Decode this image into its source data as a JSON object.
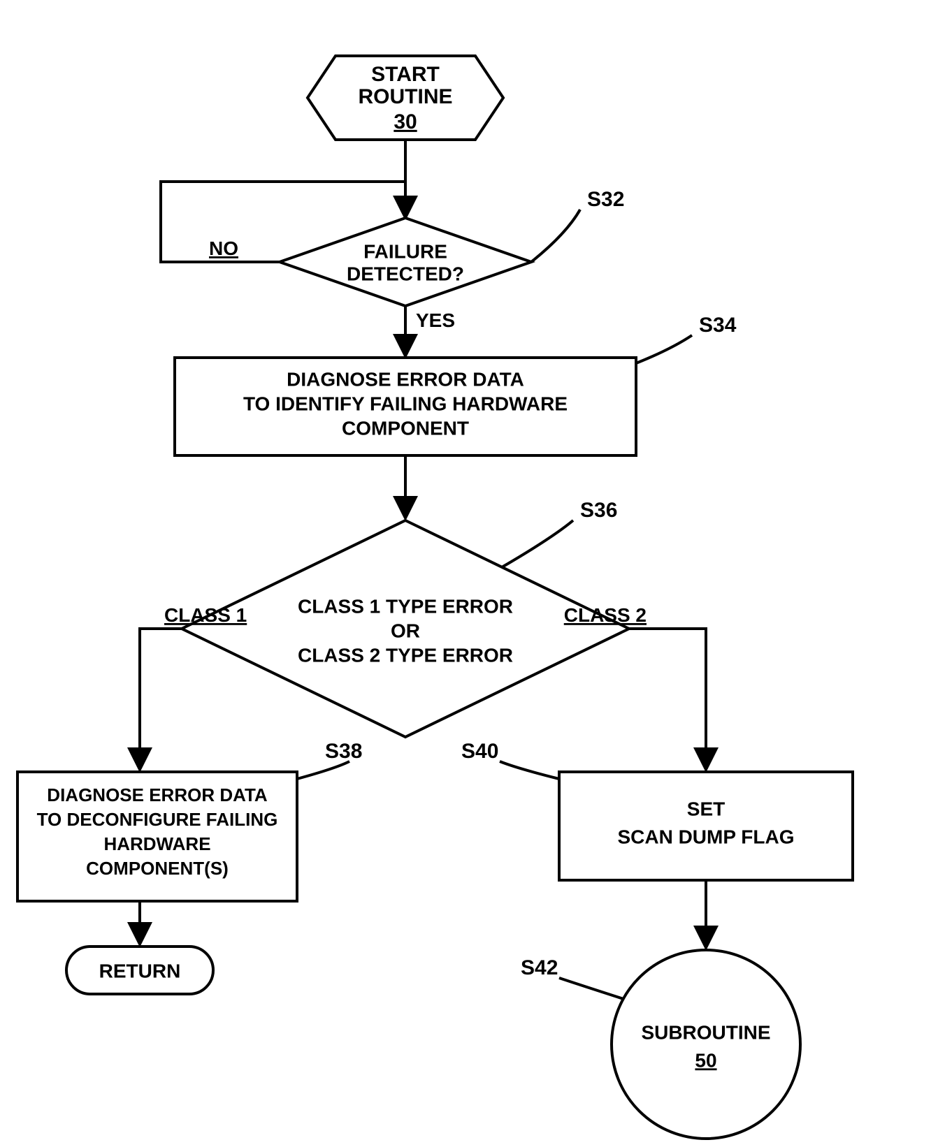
{
  "chart_data": {
    "type": "flowchart",
    "nodes": [
      {
        "id": "start",
        "shape": "hexagon",
        "lines": [
          "START",
          "ROUTINE"
        ],
        "ref": "30"
      },
      {
        "id": "decision1",
        "shape": "diamond",
        "lines": [
          "FAILURE",
          "DETECTED?"
        ],
        "callout": "S32"
      },
      {
        "id": "process1",
        "shape": "rect",
        "lines": [
          "DIAGNOSE ERROR DATA",
          "TO IDENTIFY FAILING HARDWARE",
          "COMPONENT"
        ],
        "callout": "S34"
      },
      {
        "id": "decision2",
        "shape": "diamond",
        "lines": [
          "CLASS 1 TYPE ERROR",
          "OR",
          "CLASS 2 TYPE ERROR"
        ],
        "callout": "S36"
      },
      {
        "id": "process2",
        "shape": "rect",
        "lines": [
          "DIAGNOSE ERROR DATA",
          "TO DECONFIGURE FAILING",
          "HARDWARE",
          "COMPONENT(S)"
        ],
        "callout": "S38"
      },
      {
        "id": "process3",
        "shape": "rect",
        "lines": [
          "SET",
          "SCAN DUMP FLAG"
        ],
        "callout": "S40"
      },
      {
        "id": "return",
        "shape": "terminator",
        "lines": [
          "RETURN"
        ]
      },
      {
        "id": "subroutine",
        "shape": "circle",
        "lines": [
          "SUBROUTINE"
        ],
        "ref": "50",
        "callout": "S42"
      }
    ],
    "edges": [
      {
        "from": "start",
        "to": "decision1"
      },
      {
        "from": "decision1",
        "to": "decision1",
        "label": "NO",
        "loop": true
      },
      {
        "from": "decision1",
        "to": "process1",
        "label": "YES"
      },
      {
        "from": "process1",
        "to": "decision2"
      },
      {
        "from": "decision2",
        "to": "process2",
        "label": "CLASS 1"
      },
      {
        "from": "decision2",
        "to": "process3",
        "label": "CLASS 2"
      },
      {
        "from": "process2",
        "to": "return"
      },
      {
        "from": "process3",
        "to": "subroutine"
      }
    ]
  },
  "labels": {
    "start_l1": "START",
    "start_l2": "ROUTINE",
    "start_ref": "30",
    "d1_l1": "FAILURE",
    "d1_l2": "DETECTED?",
    "d1_callout": "S32",
    "d1_no": "NO",
    "d1_yes": "YES",
    "p1_l1": "DIAGNOSE ERROR DATA",
    "p1_l2": "TO IDENTIFY FAILING HARDWARE",
    "p1_l3": "COMPONENT",
    "p1_callout": "S34",
    "d2_l1": "CLASS 1 TYPE ERROR",
    "d2_l2": "OR",
    "d2_l3": "CLASS 2 TYPE ERROR",
    "d2_callout": "S36",
    "d2_left": "CLASS 1",
    "d2_right": "CLASS 2",
    "p2_l1": "DIAGNOSE ERROR DATA",
    "p2_l2": "TO DECONFIGURE FAILING",
    "p2_l3": "HARDWARE",
    "p2_l4": "COMPONENT(S)",
    "p2_callout": "S38",
    "p3_l1": "SET",
    "p3_l2": "SCAN DUMP FLAG",
    "p3_callout": "S40",
    "return_l1": "RETURN",
    "sub_l1": "SUBROUTINE",
    "sub_ref": "50",
    "sub_callout": "S42"
  }
}
